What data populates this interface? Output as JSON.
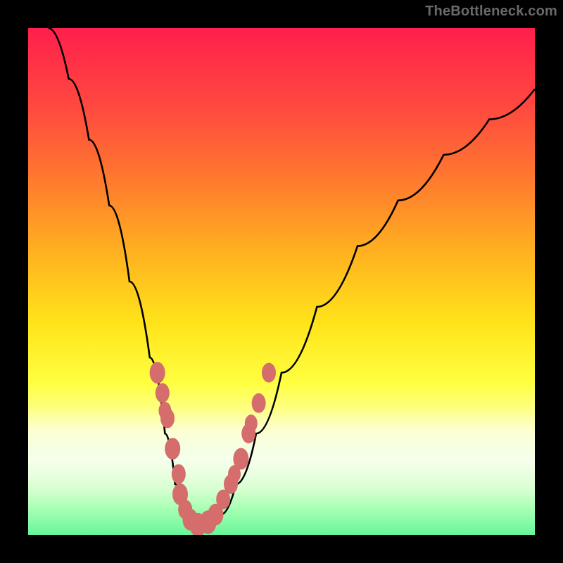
{
  "attribution": "TheBottleneck.com",
  "chart_data": {
    "type": "line",
    "title": "",
    "xlabel": "",
    "ylabel": "",
    "xlim": [
      0,
      100
    ],
    "ylim": [
      0,
      100
    ],
    "curve": [
      {
        "x": 4,
        "y": 100
      },
      {
        "x": 8,
        "y": 90
      },
      {
        "x": 12,
        "y": 78
      },
      {
        "x": 16,
        "y": 65
      },
      {
        "x": 20,
        "y": 50
      },
      {
        "x": 24,
        "y": 35
      },
      {
        "x": 27,
        "y": 20
      },
      {
        "x": 29,
        "y": 10
      },
      {
        "x": 31,
        "y": 4
      },
      {
        "x": 33,
        "y": 1
      },
      {
        "x": 35,
        "y": 1
      },
      {
        "x": 38,
        "y": 4
      },
      {
        "x": 41,
        "y": 10
      },
      {
        "x": 45,
        "y": 20
      },
      {
        "x": 50,
        "y": 32
      },
      {
        "x": 57,
        "y": 45
      },
      {
        "x": 65,
        "y": 57
      },
      {
        "x": 73,
        "y": 66
      },
      {
        "x": 82,
        "y": 75
      },
      {
        "x": 91,
        "y": 82
      },
      {
        "x": 100,
        "y": 88
      }
    ],
    "markers": [
      {
        "x": 25.5,
        "y": 32,
        "r": 11
      },
      {
        "x": 26.5,
        "y": 28,
        "r": 10
      },
      {
        "x": 27.5,
        "y": 23,
        "r": 10
      },
      {
        "x": 27.0,
        "y": 24.5,
        "r": 9
      },
      {
        "x": 28.5,
        "y": 17,
        "r": 11
      },
      {
        "x": 29.7,
        "y": 12,
        "r": 10
      },
      {
        "x": 30.0,
        "y": 8,
        "r": 11
      },
      {
        "x": 31.0,
        "y": 5,
        "r": 10
      },
      {
        "x": 32.0,
        "y": 3,
        "r": 11
      },
      {
        "x": 33.5,
        "y": 2,
        "r": 12
      },
      {
        "x": 35.5,
        "y": 2.5,
        "r": 12
      },
      {
        "x": 37.0,
        "y": 4,
        "r": 11
      },
      {
        "x": 38.5,
        "y": 7,
        "r": 10
      },
      {
        "x": 40.0,
        "y": 10,
        "r": 10
      },
      {
        "x": 40.7,
        "y": 12,
        "r": 9
      },
      {
        "x": 42.0,
        "y": 15,
        "r": 11
      },
      {
        "x": 43.5,
        "y": 20,
        "r": 10
      },
      {
        "x": 44.0,
        "y": 22,
        "r": 9
      },
      {
        "x": 45.5,
        "y": 26,
        "r": 10
      },
      {
        "x": 47.5,
        "y": 32,
        "r": 10
      }
    ],
    "gradient_stops": [
      {
        "pct": 0,
        "color": "#ff1f4c"
      },
      {
        "pct": 16,
        "color": "#ff4a3f"
      },
      {
        "pct": 30,
        "color": "#ff7a2e"
      },
      {
        "pct": 44,
        "color": "#ffb020"
      },
      {
        "pct": 58,
        "color": "#ffe31a"
      },
      {
        "pct": 70,
        "color": "#ffff40"
      },
      {
        "pct": 80,
        "color": "#fbffc0"
      },
      {
        "pct": 86,
        "color": "#d4ffb0"
      },
      {
        "pct": 91,
        "color": "#9cff8e"
      },
      {
        "pct": 95,
        "color": "#4aff66"
      },
      {
        "pct": 100,
        "color": "#00ef58"
      }
    ]
  }
}
